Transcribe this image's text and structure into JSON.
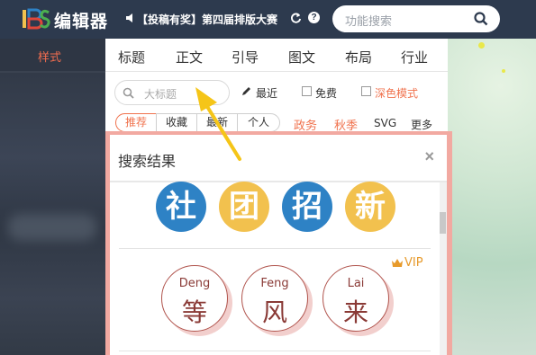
{
  "header": {
    "brand": "编辑器",
    "notice": "【投稿有奖】第四届排版大赛",
    "search_placeholder": "功能搜索"
  },
  "sidebar": {
    "items": [
      {
        "label": "样式",
        "active": true
      }
    ]
  },
  "main": {
    "tabs": [
      {
        "label": "标题"
      },
      {
        "label": "正文"
      },
      {
        "label": "引导"
      },
      {
        "label": "图文"
      },
      {
        "label": "布局"
      },
      {
        "label": "行业"
      }
    ],
    "search_placeholder": "大标题",
    "options": {
      "recent": "最近",
      "free": "免费",
      "dark_mode": "深色模式"
    },
    "subtabs": [
      {
        "label": "推荐",
        "active": true
      },
      {
        "label": "收藏"
      },
      {
        "label": "最新"
      },
      {
        "label": "个人"
      }
    ],
    "extra_tabs": [
      {
        "label": "政务",
        "color": "#f0724d"
      },
      {
        "label": "秋季",
        "color": "#f0724d"
      },
      {
        "label": "SVG",
        "color": "#333333"
      },
      {
        "label": "更多",
        "color": "#333333"
      }
    ]
  },
  "dialog": {
    "title": "搜索结果",
    "close": "×",
    "result1": {
      "chars": [
        {
          "char": "社",
          "color": "blue"
        },
        {
          "char": "团",
          "color": "gold"
        },
        {
          "char": "招",
          "color": "blue"
        },
        {
          "char": "新",
          "color": "gold"
        }
      ]
    },
    "result2": {
      "badge": "VIP",
      "items": [
        {
          "pinyin": "Deng",
          "char": "等"
        },
        {
          "pinyin": "Feng",
          "char": "风"
        },
        {
          "pinyin": "Lai",
          "char": "来"
        }
      ]
    }
  },
  "colors": {
    "accent": "#f0724d",
    "topbar": "#2d3a4e",
    "dialog_border": "#f2a9a1",
    "vip": "#e79a2b",
    "arrow": "#f5c518"
  }
}
